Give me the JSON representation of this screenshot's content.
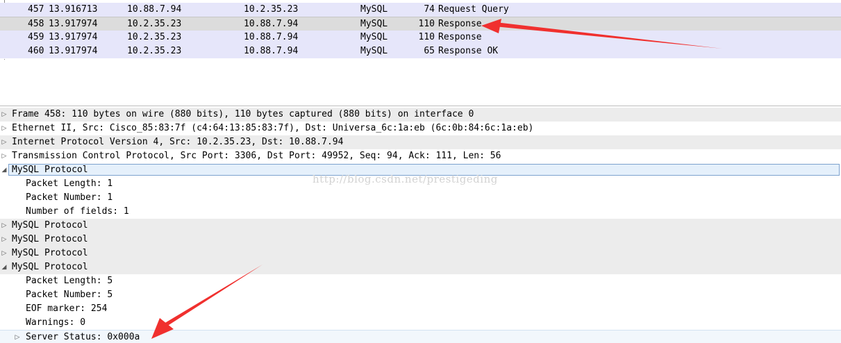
{
  "packet_list": {
    "rows": [
      {
        "no": "457",
        "time": "13.916713",
        "source": "10.88.7.94",
        "destination": "10.2.35.23",
        "protocol": "MySQL",
        "length": "74",
        "info": "Request Query",
        "selected": false
      },
      {
        "no": "458",
        "time": "13.917974",
        "source": "10.2.35.23",
        "destination": "10.88.7.94",
        "protocol": "MySQL",
        "length": "110",
        "info": "Response",
        "selected": true
      },
      {
        "no": "459",
        "time": "13.917974",
        "source": "10.2.35.23",
        "destination": "10.88.7.94",
        "protocol": "MySQL",
        "length": "110",
        "info": "Response",
        "selected": false
      },
      {
        "no": "460",
        "time": "13.917974",
        "source": "10.2.35.23",
        "destination": "10.88.7.94",
        "protocol": "MySQL",
        "length": "65",
        "info": "Response OK",
        "selected": false
      }
    ]
  },
  "details": {
    "rows": [
      {
        "text": "Frame 458: 110 bytes on wire (880 bits), 110 bytes captured (880 bits) on interface 0",
        "level": 0,
        "expander": "collapsed"
      },
      {
        "text": "Ethernet II, Src: Cisco_85:83:7f (c4:64:13:85:83:7f), Dst: Universa_6c:1a:eb (6c:0b:84:6c:1a:eb)",
        "level": 0,
        "expander": "collapsed"
      },
      {
        "text": "Internet Protocol Version 4, Src: 10.2.35.23, Dst: 10.88.7.94",
        "level": 0,
        "expander": "collapsed"
      },
      {
        "text": "Transmission Control Protocol, Src Port: 3306, Dst Port: 49952, Seq: 94, Ack: 111, Len: 56",
        "level": 0,
        "expander": "collapsed"
      },
      {
        "text": "MySQL Protocol",
        "level": 0,
        "expander": "expanded",
        "selected": true
      },
      {
        "text": "Packet Length: 1",
        "level": 1,
        "expander": "none"
      },
      {
        "text": "Packet Number: 1",
        "level": 1,
        "expander": "none"
      },
      {
        "text": "Number of fields: 1",
        "level": 1,
        "expander": "none"
      },
      {
        "text": "MySQL Protocol",
        "level": 0,
        "expander": "collapsed"
      },
      {
        "text": "MySQL Protocol",
        "level": 0,
        "expander": "collapsed"
      },
      {
        "text": "MySQL Protocol",
        "level": 0,
        "expander": "collapsed"
      },
      {
        "text": "MySQL Protocol",
        "level": 0,
        "expander": "expanded"
      },
      {
        "text": "Packet Length: 5",
        "level": 1,
        "expander": "none"
      },
      {
        "text": "Packet Number: 5",
        "level": 1,
        "expander": "none"
      },
      {
        "text": "EOF marker: 254",
        "level": 1,
        "expander": "none"
      },
      {
        "text": "Warnings: 0",
        "level": 1,
        "expander": "none"
      },
      {
        "text": "Server Status: 0x000a",
        "level": 1,
        "expander": "collapsed",
        "boxed": true
      }
    ]
  },
  "watermark": "http://blog.csdn.net/prestigeding",
  "colors": {
    "packet_row_bg": "#e6e6fa",
    "selected_row_bg": "#dcdcdc",
    "detail_shade": "#ececec",
    "tree_selection_bg": "#e5f0fb",
    "tree_selection_border": "#7da2ce",
    "annotation_arrow": "#f0302e"
  },
  "icons": {
    "collapsed": "triangle-right-icon",
    "expanded": "triangle-down-icon"
  }
}
